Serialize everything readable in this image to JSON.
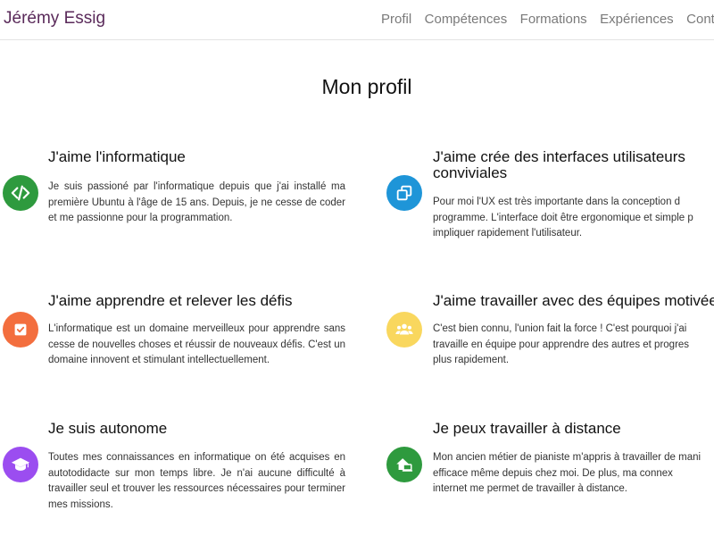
{
  "navbar": {
    "brand": "Jérémy Essig",
    "links": [
      "Profil",
      "Compétences",
      "Formations",
      "Expériences",
      "Contact"
    ]
  },
  "page_title": "Mon profil",
  "features": [
    {
      "title": "J'aime l'informatique",
      "text": "Je suis passioné par l'informatique depuis que j'ai installé ma première Ubuntu à l'âge de 15 ans. Depuis, je ne cesse de coder et me passionne pour la programmation.",
      "icon": "code-icon",
      "color": "#2e9a3e"
    },
    {
      "title": "J'aime crée des interfaces utilisateurs conviviales",
      "text_lines": [
        "Pour moi l'UX est très importante dans la conception d",
        "programme. L'interface doit être ergonomique et simple p",
        "impliquer rapidement l'utilisateur."
      ],
      "icon": "windows-icon",
      "color": "#1e95d8"
    },
    {
      "title": "J'aime apprendre et relever les défis",
      "text": "L'informatique est un domaine merveilleux pour apprendre sans cesse de nouvelles choses et réussir de nouveaux défis. C'est un domaine innovent et stimulant intellectuellement.",
      "icon": "check-square-icon",
      "color": "#f36e3e"
    },
    {
      "title": "J'aime travailler avec des équipes motivée",
      "text_lines": [
        "C'est bien connu, l'union fait la force ! C'est pourquoi j'ai",
        "travaille en équipe pour apprendre des autres et progres",
        "plus rapidement."
      ],
      "icon": "team-icon",
      "color": "#f9d75e"
    },
    {
      "title": "Je suis autonome",
      "text": "Toutes mes connaissances en informatique on été acquises en autotodidacte sur mon temps libre. Je n'ai aucune difficulté à travailler seul et trouver les ressources nécessaires pour terminer mes missions.",
      "icon": "graduation-cap-icon",
      "color": "#9b4df0"
    },
    {
      "title": "Je peux travailler à distance",
      "text_lines": [
        "Mon ancien métier de pianiste m'appris à travailler de mani",
        "efficace même depuis chez moi. De plus, ma connex",
        "internet me permet de travailler à distance."
      ],
      "icon": "home-laptop-icon",
      "color": "#2e9a3e"
    }
  ]
}
